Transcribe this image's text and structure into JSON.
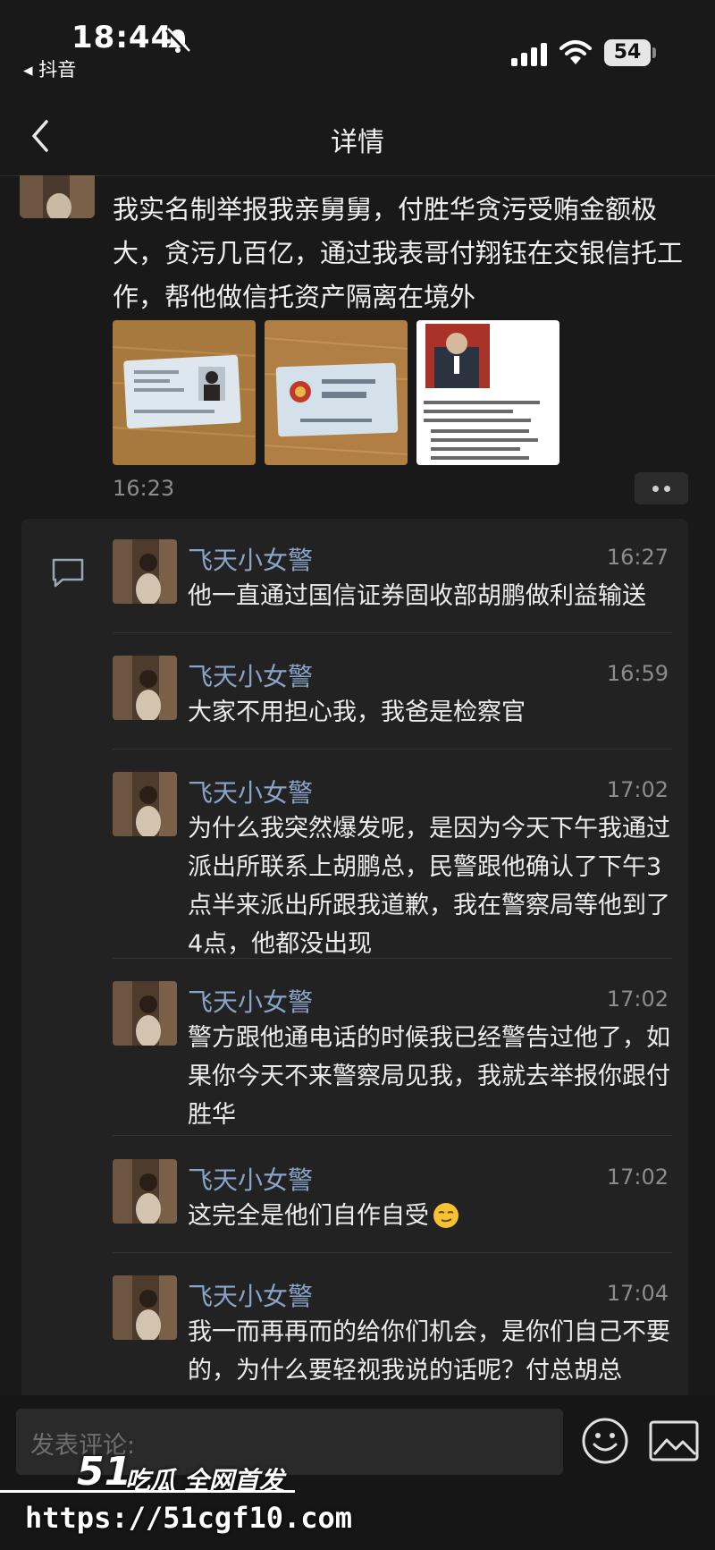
{
  "status_bar": {
    "time": "18:44",
    "back_app": "◂ 抖音",
    "battery": "54"
  },
  "nav": {
    "title": "详情"
  },
  "post": {
    "text": "我实名制举报我亲舅舅，付胜华贪污受贿金额极大，贪污几百亿，通过我表哥付翔钰在交银信托工作，帮他做信托资产隔离在境外",
    "time": "16:23"
  },
  "comments": [
    {
      "name": "飞天小女警",
      "time": "16:27",
      "text": "他一直通过国信证券固收部胡鹏做利益输送"
    },
    {
      "name": "飞天小女警",
      "time": "16:59",
      "text": "大家不用担心我，我爸是检察官"
    },
    {
      "name": "飞天小女警",
      "time": "17:02",
      "text": "为什么我突然爆发呢，是因为今天下午我通过派出所联系上胡鹏总，民警跟他确认了下午3点半来派出所跟我道歉，我在警察局等他到了4点，他都没出现"
    },
    {
      "name": "飞天小女警",
      "time": "17:02",
      "text": "警方跟他通电话的时候我已经警告过他了，如果你今天不来警察局见我，我就去举报你跟付胜华"
    },
    {
      "name": "飞天小女警",
      "time": "17:02",
      "text": "这完全是他们自作自受"
    },
    {
      "name": "飞天小女警",
      "time": "17:04",
      "text": "我一而再再而的给你们机会，是你们自己不要的，为什么要轻视我说的话呢？付总胡总"
    }
  ],
  "input": {
    "placeholder": "发表评论:"
  },
  "watermark": {
    "logo": "51",
    "slogan": "吃瓜 全网首发",
    "url": "https://51cgf10.com"
  }
}
